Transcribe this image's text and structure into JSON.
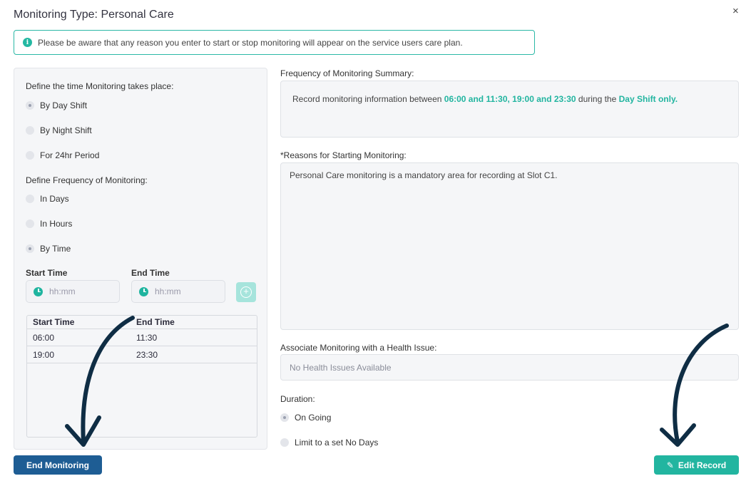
{
  "dialog": {
    "title": "Monitoring Type: Personal Care",
    "close_glyph": "×",
    "notice": "Please be aware that any reason you enter to start or stop monitoring will appear on the service users care plan."
  },
  "left": {
    "define_time_label": "Define the time Monitoring takes place:",
    "time_options": [
      {
        "label": "By Day Shift",
        "checked": true
      },
      {
        "label": "By Night Shift",
        "checked": false
      },
      {
        "label": "For 24hr Period",
        "checked": false
      }
    ],
    "define_freq_label": "Define Frequency of Monitoring:",
    "freq_options": [
      {
        "label": "In Days",
        "checked": false
      },
      {
        "label": "In Hours",
        "checked": false
      },
      {
        "label": "By Time",
        "checked": true
      }
    ],
    "start_time_label": "Start Time",
    "end_time_label": "End Time",
    "time_placeholder": "hh:mm",
    "table": {
      "headers": [
        "Start Time",
        "End Time"
      ],
      "rows": [
        [
          "06:00",
          "11:30"
        ],
        [
          "19:00",
          "23:30"
        ]
      ]
    }
  },
  "right": {
    "summary_label": "Frequency of Monitoring Summary:",
    "summary_prefix": "Record monitoring information between ",
    "summary_times": "06:00 and 11:30, 19:00 and 23:30",
    "summary_middle": " during the ",
    "summary_shift": "Day Shift only.",
    "reasons_label": "*Reasons for Starting Monitoring:",
    "reasons_text": "Personal Care monitoring is a mandatory area for recording at Slot C1.",
    "health_label": "Associate Monitoring with a Health Issue:",
    "health_value": "No Health Issues Available",
    "duration_label": "Duration:",
    "duration_options": [
      {
        "label": "On Going",
        "checked": true
      },
      {
        "label": "Limit to a set No Days",
        "checked": false
      }
    ]
  },
  "buttons": {
    "end": "End Monitoring",
    "edit": "Edit Record"
  },
  "colors": {
    "accent": "#22b5a0",
    "primary": "#1e5d94",
    "arrow": "#0f2d44"
  }
}
